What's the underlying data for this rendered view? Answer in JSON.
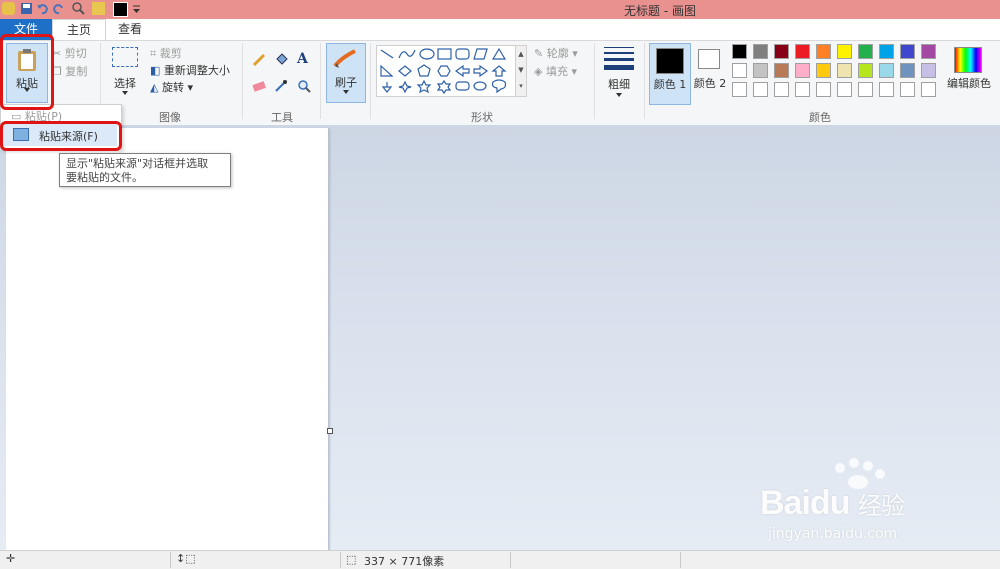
{
  "window": {
    "title": "无标题 - 画图"
  },
  "tabs": [
    {
      "label": "文件"
    },
    {
      "label": "主页"
    },
    {
      "label": "查看"
    }
  ],
  "ribbon": {
    "clipboard": {
      "paste_label": "粘贴",
      "cut_label": "剪切",
      "copy_label": "复制"
    },
    "image": {
      "select_label": "选择",
      "crop_label": "裁剪",
      "resize_label": "重新调整大小",
      "rotate_label": "旋转",
      "group_label": "图像"
    },
    "tools": {
      "group_label": "工具"
    },
    "brush": {
      "label": "刷子"
    },
    "shapes": {
      "outline_label": "轮廓",
      "fill_label": "填充",
      "group_label": "形状"
    },
    "size": {
      "label": "粗细"
    },
    "colors": {
      "color1_label": "颜色 1",
      "color2_label": "颜色 2",
      "edit_label": "编辑颜色",
      "group_label": "颜色",
      "palette_row1": [
        "#000000",
        "#7f7f7f",
        "#880015",
        "#ed1c24",
        "#ff7f27",
        "#fff200",
        "#22b14c",
        "#00a2e8",
        "#3f48cc",
        "#a349a4"
      ],
      "palette_row2": [
        "#ffffff",
        "#c3c3c3",
        "#b97a57",
        "#ffaec9",
        "#ffc90e",
        "#efe4b0",
        "#b5e61d",
        "#99d9ea",
        "#7092be",
        "#c8bfe7"
      ]
    }
  },
  "paste_menu": {
    "paste_item": "粘贴(P)",
    "paste_from_item": "粘贴来源(F)"
  },
  "tooltip": {
    "line1": "显示\"粘贴来源\"对话框并选取",
    "line2": "要粘贴的文件。"
  },
  "status": {
    "size_text": "337 × 771像素"
  },
  "watermark": {
    "brand": "Bai",
    "brand2": "du",
    "cn": "经验",
    "url": "jingyan.baidu.com"
  },
  "accent_colors": {
    "title_bar": "#e8918f",
    "file_tab": "#1e6fc7",
    "highlight": "#e01414"
  }
}
